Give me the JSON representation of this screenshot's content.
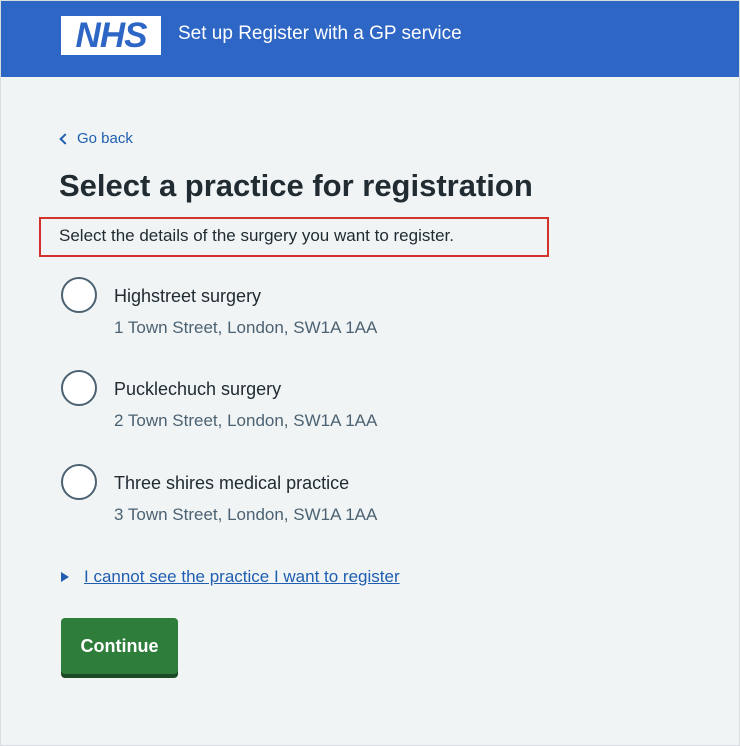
{
  "header": {
    "logo_text": "NHS",
    "service_name": "Set up Register with a GP service",
    "background_color": "#2d66c4"
  },
  "back_link": {
    "label": "Go back",
    "icon": "chevron-left-icon"
  },
  "page_title": "Select a practice for registration",
  "hint": "Select the details of the surgery you want to register.",
  "highlight_color": "#d5312b",
  "practices": [
    {
      "name": "Highstreet surgery",
      "address": "1 Town Street, London, SW1A 1AA",
      "selected": false
    },
    {
      "name": "Pucklechuch surgery",
      "address": "2 Town Street, London, SW1A 1AA",
      "selected": false
    },
    {
      "name": "Three shires medical practice",
      "address": "3 Town Street, London, SW1A 1AA",
      "selected": false
    }
  ],
  "details_link": {
    "label": "I cannot see the practice I want to register",
    "icon": "triangle-right-icon"
  },
  "continue_button": {
    "label": "Continue",
    "color": "#2e7d3a"
  }
}
